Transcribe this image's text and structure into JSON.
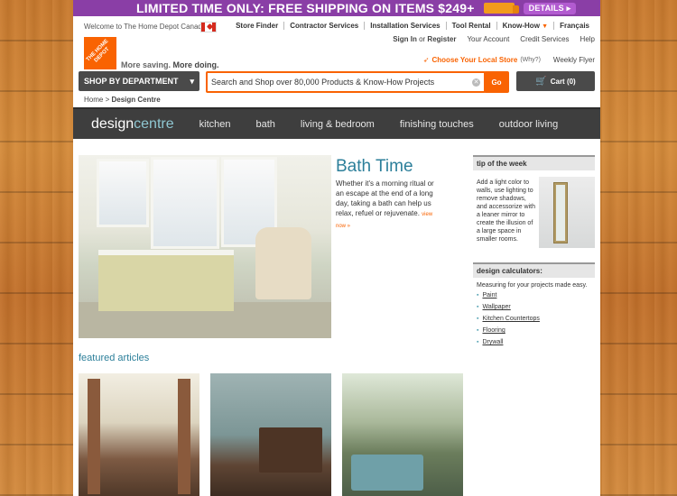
{
  "promo": {
    "text": "LIMITED TIME ONLY: FREE SHIPPING ON ITEMS $249+",
    "details": "DETAILS ▸"
  },
  "header": {
    "welcome": "Welcome to The Home Depot Canada",
    "logo": "THE HOME DEPOT",
    "tagline_a": "More saving.",
    "tagline_b": "More doing.",
    "topnav": [
      "Store Finder",
      "Contractor Services",
      "Installation Services",
      "Tool Rental",
      "Know-How",
      "Français"
    ],
    "signin": "Sign In",
    "or": " or ",
    "register": "Register",
    "account": "Your Account",
    "credit": "Credit Services",
    "help": "Help",
    "choose_store": "Choose Your Local Store",
    "why": "(Why?)",
    "flyer": "Weekly Flyer"
  },
  "search": {
    "shop_dept": "SHOP BY DEPARTMENT",
    "value": "Search and Shop over 80,000 Products & Know-How Projects",
    "go": "Go",
    "cart": "Cart (0)"
  },
  "breadcrumb": {
    "home": "Home",
    "sep": " > ",
    "current": "Design Centre"
  },
  "designcentre": {
    "logo_a": "design",
    "logo_b": "centre",
    "items": [
      "kitchen",
      "bath",
      "living & bedroom",
      "finishing touches",
      "outdoor living"
    ]
  },
  "hero": {
    "title": "Bath Time",
    "text": "Whether it's a morning ritual or an escape at the end of a long day, taking a bath can help us relax, refuel or rejuvenate.",
    "link": "view now »"
  },
  "tip": {
    "heading": "tip of the week",
    "text": "Add a light color to walls, use lighting to remove shadows, and accessorize with a leaner mirror to create the illusion of a large space in smaller rooms."
  },
  "calculators": {
    "heading": "design calculators:",
    "intro": "Measuring for your projects made easy.",
    "items": [
      "Paint",
      "Wallpaper",
      "Kitchen Countertops",
      "Flooring",
      "Drywall"
    ]
  },
  "featured": {
    "title": "featured articles"
  }
}
